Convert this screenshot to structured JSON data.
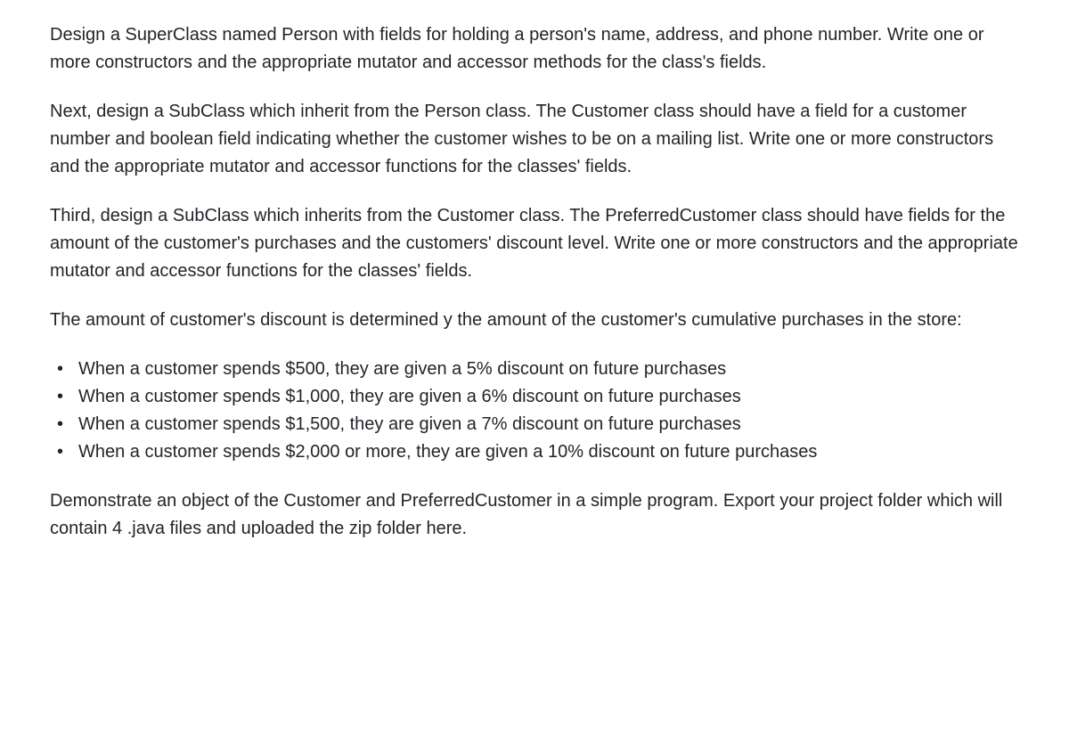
{
  "paragraphs": {
    "p1": "Design a SuperClass named Person with fields for holding a person's name, address, and phone number.  Write one or more constructors and the appropriate mutator and accessor methods for the class's fields.",
    "p2": "Next, design a SubClass which inherit from the Person class.  The Customer class should have a field for a customer number and boolean field indicating whether the customer wishes to be on a mailing list.  Write one or more constructors and the appropriate mutator and accessor functions for the classes' fields.",
    "p3": "Third, design a SubClass which inherits from the Customer class. The PreferredCustomer class should have fields for the amount of the customer's purchases and the customers' discount level.  Write one or more constructors and the appropriate mutator and accessor functions for the classes' fields.",
    "p4": "The amount of customer's discount is determined y the amount of the customer's cumulative purchases in the store:",
    "p5": "Demonstrate an object of the Customer and PreferredCustomer in a simple program.  Export your project folder which will contain 4 .java files and uploaded the zip folder here."
  },
  "bullets": [
    "When a customer spends $500, they are given a 5% discount on future purchases",
    "When a customer spends $1,000, they are given a 6% discount on future purchases",
    "When a customer spends $1,500, they are given a 7% discount on future purchases",
    "When a customer spends $2,000 or more, they are given a 10% discount on future purchases"
  ]
}
